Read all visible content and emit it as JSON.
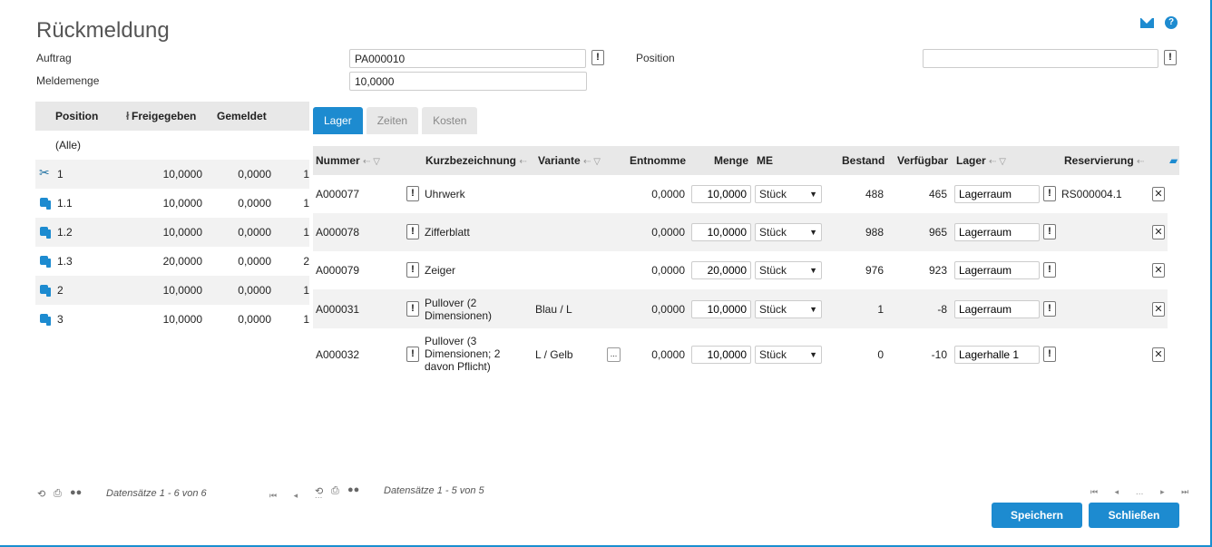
{
  "title": "Rückmeldung",
  "form": {
    "auftrag_label": "Auftrag",
    "auftrag_value": "PA000010",
    "meldemenge_label": "Meldemenge",
    "meldemenge_value": "10,0000",
    "position_label": "Position",
    "position_value": "",
    "bang": "!"
  },
  "left_grid": {
    "headers": [
      "Position",
      "Freigegeben",
      "Gemeldet"
    ],
    "all_label": "(Alle)",
    "rows": [
      {
        "pos": "1",
        "freigegeben": "10,0000",
        "gemeldet": "0,0000",
        "extra": "1",
        "icon": "scissors-icon"
      },
      {
        "pos": "1.1",
        "freigegeben": "10,0000",
        "gemeldet": "0,0000",
        "extra": "1",
        "icon": "hand-icon"
      },
      {
        "pos": "1.2",
        "freigegeben": "10,0000",
        "gemeldet": "0,0000",
        "extra": "1",
        "icon": "hand-icon"
      },
      {
        "pos": "1.3",
        "freigegeben": "20,0000",
        "gemeldet": "0,0000",
        "extra": "2",
        "icon": "hand-icon"
      },
      {
        "pos": "2",
        "freigegeben": "10,0000",
        "gemeldet": "0,0000",
        "extra": "1",
        "icon": "hand-icon"
      },
      {
        "pos": "3",
        "freigegeben": "10,0000",
        "gemeldet": "0,0000",
        "extra": "1",
        "icon": "hand-icon"
      }
    ],
    "footer": "Datensätze 1 - 6 von 6"
  },
  "tabs": [
    "Lager",
    "Zeiten",
    "Kosten"
  ],
  "right_grid": {
    "headers": {
      "nummer": "Nummer",
      "kurz": "Kurzbezeichnung",
      "variante": "Variante",
      "entnomme": "Entnomme",
      "menge": "Menge",
      "me": "ME",
      "bestand": "Bestand",
      "verfuegbar": "Verfügbar",
      "lager": "Lager",
      "reservierung": "Reservierung"
    },
    "rows": [
      {
        "nummer": "A000077",
        "kurz": "Uhrwerk",
        "variante": "",
        "entnomme": "0,0000",
        "menge": "10,0000",
        "me": "Stück",
        "bestand": "488",
        "verfuegbar": "465",
        "lager": "Lagerraum",
        "reservierung": "RS000004.1"
      },
      {
        "nummer": "A000078",
        "kurz": "Zifferblatt",
        "variante": "",
        "entnomme": "0,0000",
        "menge": "10,0000",
        "me": "Stück",
        "bestand": "988",
        "verfuegbar": "965",
        "lager": "Lagerraum",
        "reservierung": ""
      },
      {
        "nummer": "A000079",
        "kurz": "Zeiger",
        "variante": "",
        "entnomme": "0,0000",
        "menge": "20,0000",
        "me": "Stück",
        "bestand": "976",
        "verfuegbar": "923",
        "lager": "Lagerraum",
        "reservierung": ""
      },
      {
        "nummer": "A000031",
        "kurz": "Pullover (2 Dimensionen)",
        "variante": "Blau / L",
        "entnomme": "0,0000",
        "menge": "10,0000",
        "me": "Stück",
        "bestand": "1",
        "verfuegbar": "-8",
        "lager": "Lagerraum",
        "reservierung": ""
      },
      {
        "nummer": "A000032",
        "kurz": "Pullover (3 Dimensionen; 2 davon Pflicht)",
        "variante": "L / Gelb",
        "entnomme": "0,0000",
        "menge": "10,0000",
        "me": "Stück",
        "bestand": "0",
        "verfuegbar": "-10",
        "lager": "Lagerhalle 1",
        "reservierung": ""
      }
    ],
    "footer": "Datensätze 1 - 5 von 5"
  },
  "buttons": {
    "save": "Speichern",
    "close": "Schließen"
  },
  "colors": {
    "accent": "#1d8bd0"
  }
}
